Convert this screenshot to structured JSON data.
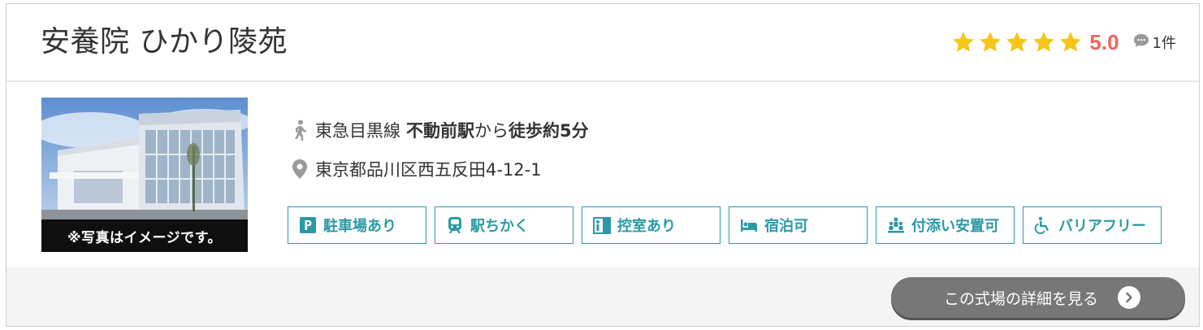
{
  "hall": {
    "name": "安養院 ひかり陵苑",
    "rating": {
      "stars": 5,
      "max_stars": 5,
      "score": "5.0",
      "review_count": "1件",
      "star_color": "#f5c518",
      "score_color": "#f0645a"
    }
  },
  "photo": {
    "caption": "※写真はイメージです。"
  },
  "access": {
    "line": "東急目黒線",
    "station": "不動前駅",
    "from": "から",
    "walk": "徒歩約5分"
  },
  "address": "東京都品川区西五反田4-12-1",
  "features": [
    {
      "label": "駐車場あり",
      "icon": "parking-icon"
    },
    {
      "label": "駅ちかく",
      "icon": "train-icon"
    },
    {
      "label": "控室あり",
      "icon": "waiting-room-icon"
    },
    {
      "label": "宿泊可",
      "icon": "bed-icon"
    },
    {
      "label": "付添い安置可",
      "icon": "attendants-icon"
    },
    {
      "label": "バリアフリー",
      "icon": "wheelchair-icon"
    }
  ],
  "feature_color": "#2a9aa6",
  "detail_button": {
    "label": "この式場の詳細を見る"
  }
}
